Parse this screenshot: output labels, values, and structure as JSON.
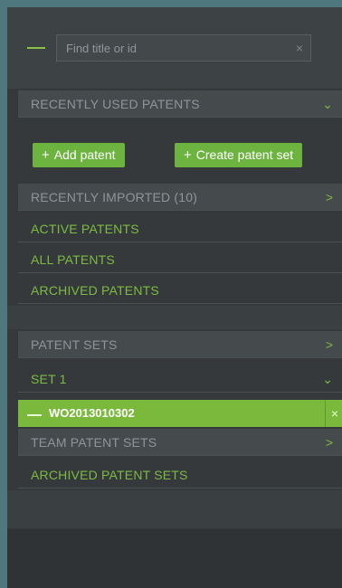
{
  "search": {
    "placeholder": "Find title or id",
    "clear_icon": "×"
  },
  "sections": {
    "recently_used": {
      "label": "RECENTLY USED PATENTS",
      "chevron": "⌄"
    },
    "buttons": {
      "add": "Add patent",
      "create_set": "Create patent set",
      "plus": "+"
    },
    "recently_imported": {
      "label": "RECENTLY IMPORTED (10)",
      "chevron": ">"
    },
    "active": {
      "label": "ACTIVE PATENTS"
    },
    "all": {
      "label": "ALL PATENTS"
    },
    "archived": {
      "label": "ARCHIVED PATENTS"
    },
    "patent_sets": {
      "label": "PATENT SETS",
      "chevron": ">"
    },
    "set1": {
      "label": "SET 1",
      "chevron": "⌄"
    },
    "selected_patent": {
      "id": "WO2013010302",
      "remove_icon": "×"
    },
    "team_sets": {
      "label": "TEAM PATENT SETS",
      "chevron": ">"
    },
    "archived_sets": {
      "label": "ARCHIVED PATENT SETS"
    }
  },
  "colors": {
    "accent": "#7dbb42",
    "button": "#6cb33f",
    "background": "#4f787e"
  }
}
